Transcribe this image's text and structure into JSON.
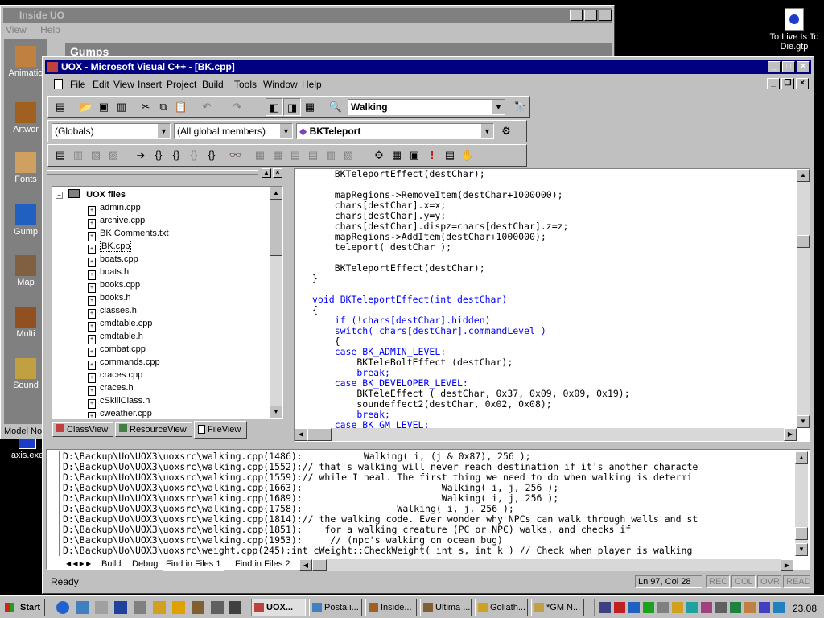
{
  "background_window": {
    "title": "Inside UO",
    "menu": [
      "View",
      "Help"
    ],
    "panel_title": "Gumps",
    "sidebar": [
      "Animatio",
      "Artwor",
      "Fonts",
      "Gump",
      "Map",
      "Multi",
      "Sound"
    ],
    "model_label": "Model No"
  },
  "desktop": {
    "top_right_icon": "To Live Is To Die.gtp",
    "left_icon": "axis.exe"
  },
  "window": {
    "title": "UOX - Microsoft Visual C++ - [BK.cpp]",
    "menu": [
      "File",
      "Edit",
      "View",
      "Insert",
      "Project",
      "Build",
      "Tools",
      "Window",
      "Help"
    ]
  },
  "toolbar": {
    "find_combo": "Walking",
    "scope_combo": "(Globals)",
    "members_combo": "(All global members)",
    "function_combo": "BKTeleport"
  },
  "workspace": {
    "root": "UOX files",
    "files": [
      "admin.cpp",
      "archive.cpp",
      "BK Comments.txt",
      "BK.cpp",
      "boats.cpp",
      "boats.h",
      "books.cpp",
      "books.h",
      "classes.h",
      "cmdtable.cpp",
      "cmdtable.h",
      "combat.cpp",
      "commands.cpp",
      "craces.cpp",
      "craces.h",
      "cSkillClass.h",
      "cweather.cpp"
    ],
    "selected": "BK.cpp",
    "tabs": [
      "ClassView",
      "ResourceView",
      "FileView"
    ]
  },
  "editor": {
    "lines": [
      "    BKTeleportEffect(destChar);",
      "",
      "    mapRegions->RemoveItem(destChar+1000000);",
      "    chars[destChar].x=x;",
      "    chars[destChar].y=y;",
      "    chars[destChar].dispz=chars[destChar].z=z;",
      "    mapRegions->AddItem(destChar+1000000);",
      "    teleport( destChar );",
      "",
      "    BKTeleportEffect(destChar);",
      "}",
      "",
      "void BKTeleportEffect(int destChar)",
      "{",
      "    if (!chars[destChar].hidden)",
      "    switch( chars[destChar].commandLevel )",
      "    {",
      "    case BK_ADMIN_LEVEL:",
      "        BKTeleBoltEffect (destChar);",
      "        break;",
      "    case BK_DEVELOPER_LEVEL:",
      "        BKTeleEffect ( destChar, 0x37, 0x09, 0x09, 0x19);",
      "        soundeffect2(destChar, 0x02, 0x08);",
      "        break;",
      "    case BK_GM_LEVEL:"
    ]
  },
  "output": {
    "lines": [
      "D:\\Backup\\Uo\\UOX3\\uoxsrc\\walking.cpp(1486):           Walking( i, (j & 0x87), 256 );",
      "D:\\Backup\\Uo\\UOX3\\uoxsrc\\walking.cpp(1552):// that's walking will never reach destination if it's another characte",
      "D:\\Backup\\Uo\\UOX3\\uoxsrc\\walking.cpp(1559):// while I heal. The first thing we need to do when walking is determi",
      "D:\\Backup\\Uo\\UOX3\\uoxsrc\\walking.cpp(1663):                         Walking( i, j, 256 );",
      "D:\\Backup\\Uo\\UOX3\\uoxsrc\\walking.cpp(1689):                         Walking( i, j, 256 );",
      "D:\\Backup\\Uo\\UOX3\\uoxsrc\\walking.cpp(1758):                 Walking( i, j, 256 );",
      "D:\\Backup\\Uo\\UOX3\\uoxsrc\\walking.cpp(1814):// the walking code. Ever wonder why NPCs can walk through walls and st",
      "D:\\Backup\\Uo\\UOX3\\uoxsrc\\walking.cpp(1851):    for a walking creature (PC or NPC) walks, and checks if",
      "D:\\Backup\\Uo\\UOX3\\uoxsrc\\walking.cpp(1953):     // (npc's walking on ocean bug)",
      "D:\\Backup\\Uo\\UOX3\\uoxsrc\\weight.cpp(245):int cWeight::CheckWeight( int s, int k ) // Check when player is walking"
    ],
    "tabs": [
      "Build",
      "Debug",
      "Find in Files 1",
      "Find in Files 2"
    ],
    "active_tab": "Find in Files 1"
  },
  "status": {
    "text": "Ready",
    "position": "Ln 97, Col 28",
    "indicators": [
      "REC",
      "COL",
      "OVR",
      "READ"
    ]
  },
  "taskbar": {
    "start": "Start",
    "tasks": [
      "UOX...",
      "Posta i...",
      "Inside...",
      "Ultima ...",
      "Goliath...",
      "*GM N..."
    ],
    "clock": "23.08"
  }
}
